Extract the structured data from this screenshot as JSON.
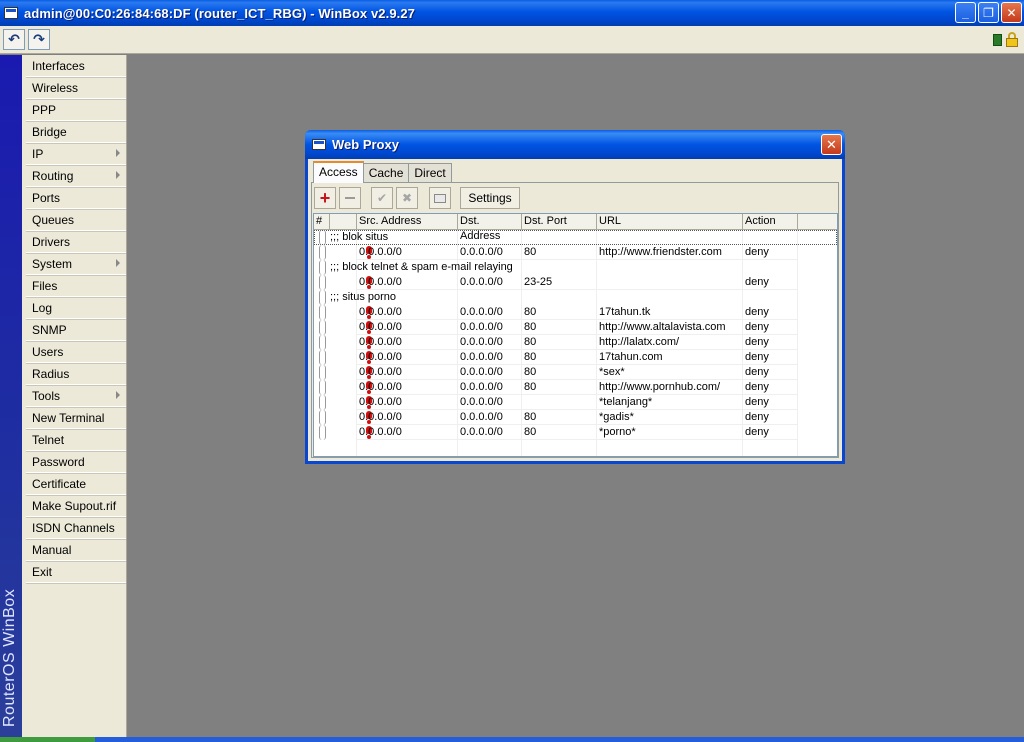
{
  "window": {
    "title": "admin@00:C0:26:84:68:DF (router_ICT_RBG) - WinBox v2.9.27",
    "buttons": {
      "minimize": "_",
      "maximize": "❐",
      "close": "✕"
    }
  },
  "toolbar": {
    "undo_icon": "↶",
    "redo_icon": "↷"
  },
  "brand": "RouterOS WinBox",
  "sidebar": {
    "items": [
      {
        "label": "Interfaces",
        "has_submenu": false
      },
      {
        "label": "Wireless",
        "has_submenu": false
      },
      {
        "label": "PPP",
        "has_submenu": false
      },
      {
        "label": "Bridge",
        "has_submenu": false
      },
      {
        "label": "IP",
        "has_submenu": true
      },
      {
        "label": "Routing",
        "has_submenu": true
      },
      {
        "label": "Ports",
        "has_submenu": false
      },
      {
        "label": "Queues",
        "has_submenu": false
      },
      {
        "label": "Drivers",
        "has_submenu": false
      },
      {
        "label": "System",
        "has_submenu": true
      },
      {
        "label": "Files",
        "has_submenu": false
      },
      {
        "label": "Log",
        "has_submenu": false
      },
      {
        "label": "SNMP",
        "has_submenu": false
      },
      {
        "label": "Users",
        "has_submenu": false
      },
      {
        "label": "Radius",
        "has_submenu": false
      },
      {
        "label": "Tools",
        "has_submenu": true
      },
      {
        "label": "New Terminal",
        "has_submenu": false
      },
      {
        "label": "Telnet",
        "has_submenu": false
      },
      {
        "label": "Password",
        "has_submenu": false
      },
      {
        "label": "Certificate",
        "has_submenu": false
      },
      {
        "label": "Make Supout.rif",
        "has_submenu": false
      },
      {
        "label": "ISDN Channels",
        "has_submenu": false
      },
      {
        "label": "Manual",
        "has_submenu": false
      },
      {
        "label": "Exit",
        "has_submenu": false
      }
    ]
  },
  "proxy": {
    "title": "Web Proxy",
    "close_label": "✕",
    "tabs": [
      {
        "label": "Access",
        "active": true
      },
      {
        "label": "Cache",
        "active": false
      },
      {
        "label": "Direct",
        "active": false
      }
    ],
    "toolbar": {
      "add_icon": "+",
      "check_icon": "✔",
      "cross_icon": "✖",
      "settings_label": "Settings"
    },
    "columns": [
      "#",
      "Src. Address",
      "Dst. Address",
      "Dst. Port",
      "URL",
      "Action"
    ],
    "rows": [
      {
        "type": "comment",
        "text": ";;; blok situs"
      },
      {
        "type": "rule",
        "src": "0.0.0.0/0",
        "dst": "0.0.0.0/0",
        "port": "80",
        "url": "http://www.friendster.com",
        "action": "deny"
      },
      {
        "type": "comment",
        "text": ";;; block telnet & spam e-mail relaying"
      },
      {
        "type": "rule",
        "src": "0.0.0.0/0",
        "dst": "0.0.0.0/0",
        "port": "23-25",
        "url": "",
        "action": "deny"
      },
      {
        "type": "comment",
        "text": ";;; situs porno"
      },
      {
        "type": "rule",
        "src": "0.0.0.0/0",
        "dst": "0.0.0.0/0",
        "port": "80",
        "url": "17tahun.tk",
        "action": "deny"
      },
      {
        "type": "rule",
        "src": "0.0.0.0/0",
        "dst": "0.0.0.0/0",
        "port": "80",
        "url": "http://www.altalavista.com",
        "action": "deny"
      },
      {
        "type": "rule",
        "src": "0.0.0.0/0",
        "dst": "0.0.0.0/0",
        "port": "80",
        "url": "http://lalatx.com/",
        "action": "deny"
      },
      {
        "type": "rule",
        "src": "0.0.0.0/0",
        "dst": "0.0.0.0/0",
        "port": "80",
        "url": "17tahun.com",
        "action": "deny"
      },
      {
        "type": "rule",
        "src": "0.0.0.0/0",
        "dst": "0.0.0.0/0",
        "port": "80",
        "url": "*sex*",
        "action": "deny"
      },
      {
        "type": "rule",
        "src": "0.0.0.0/0",
        "dst": "0.0.0.0/0",
        "port": "80",
        "url": "http://www.pornhub.com/",
        "action": "deny"
      },
      {
        "type": "rule",
        "src": "0.0.0.0/0",
        "dst": "0.0.0.0/0",
        "port": "",
        "url": "*telanjang*",
        "action": "deny"
      },
      {
        "type": "rule",
        "src": "0.0.0.0/0",
        "dst": "0.0.0.0/0",
        "port": "80",
        "url": "*gadis*",
        "action": "deny"
      },
      {
        "type": "rule",
        "src": "0.0.0.0/0",
        "dst": "0.0.0.0/0",
        "port": "80",
        "url": "*porno*",
        "action": "deny"
      }
    ]
  }
}
